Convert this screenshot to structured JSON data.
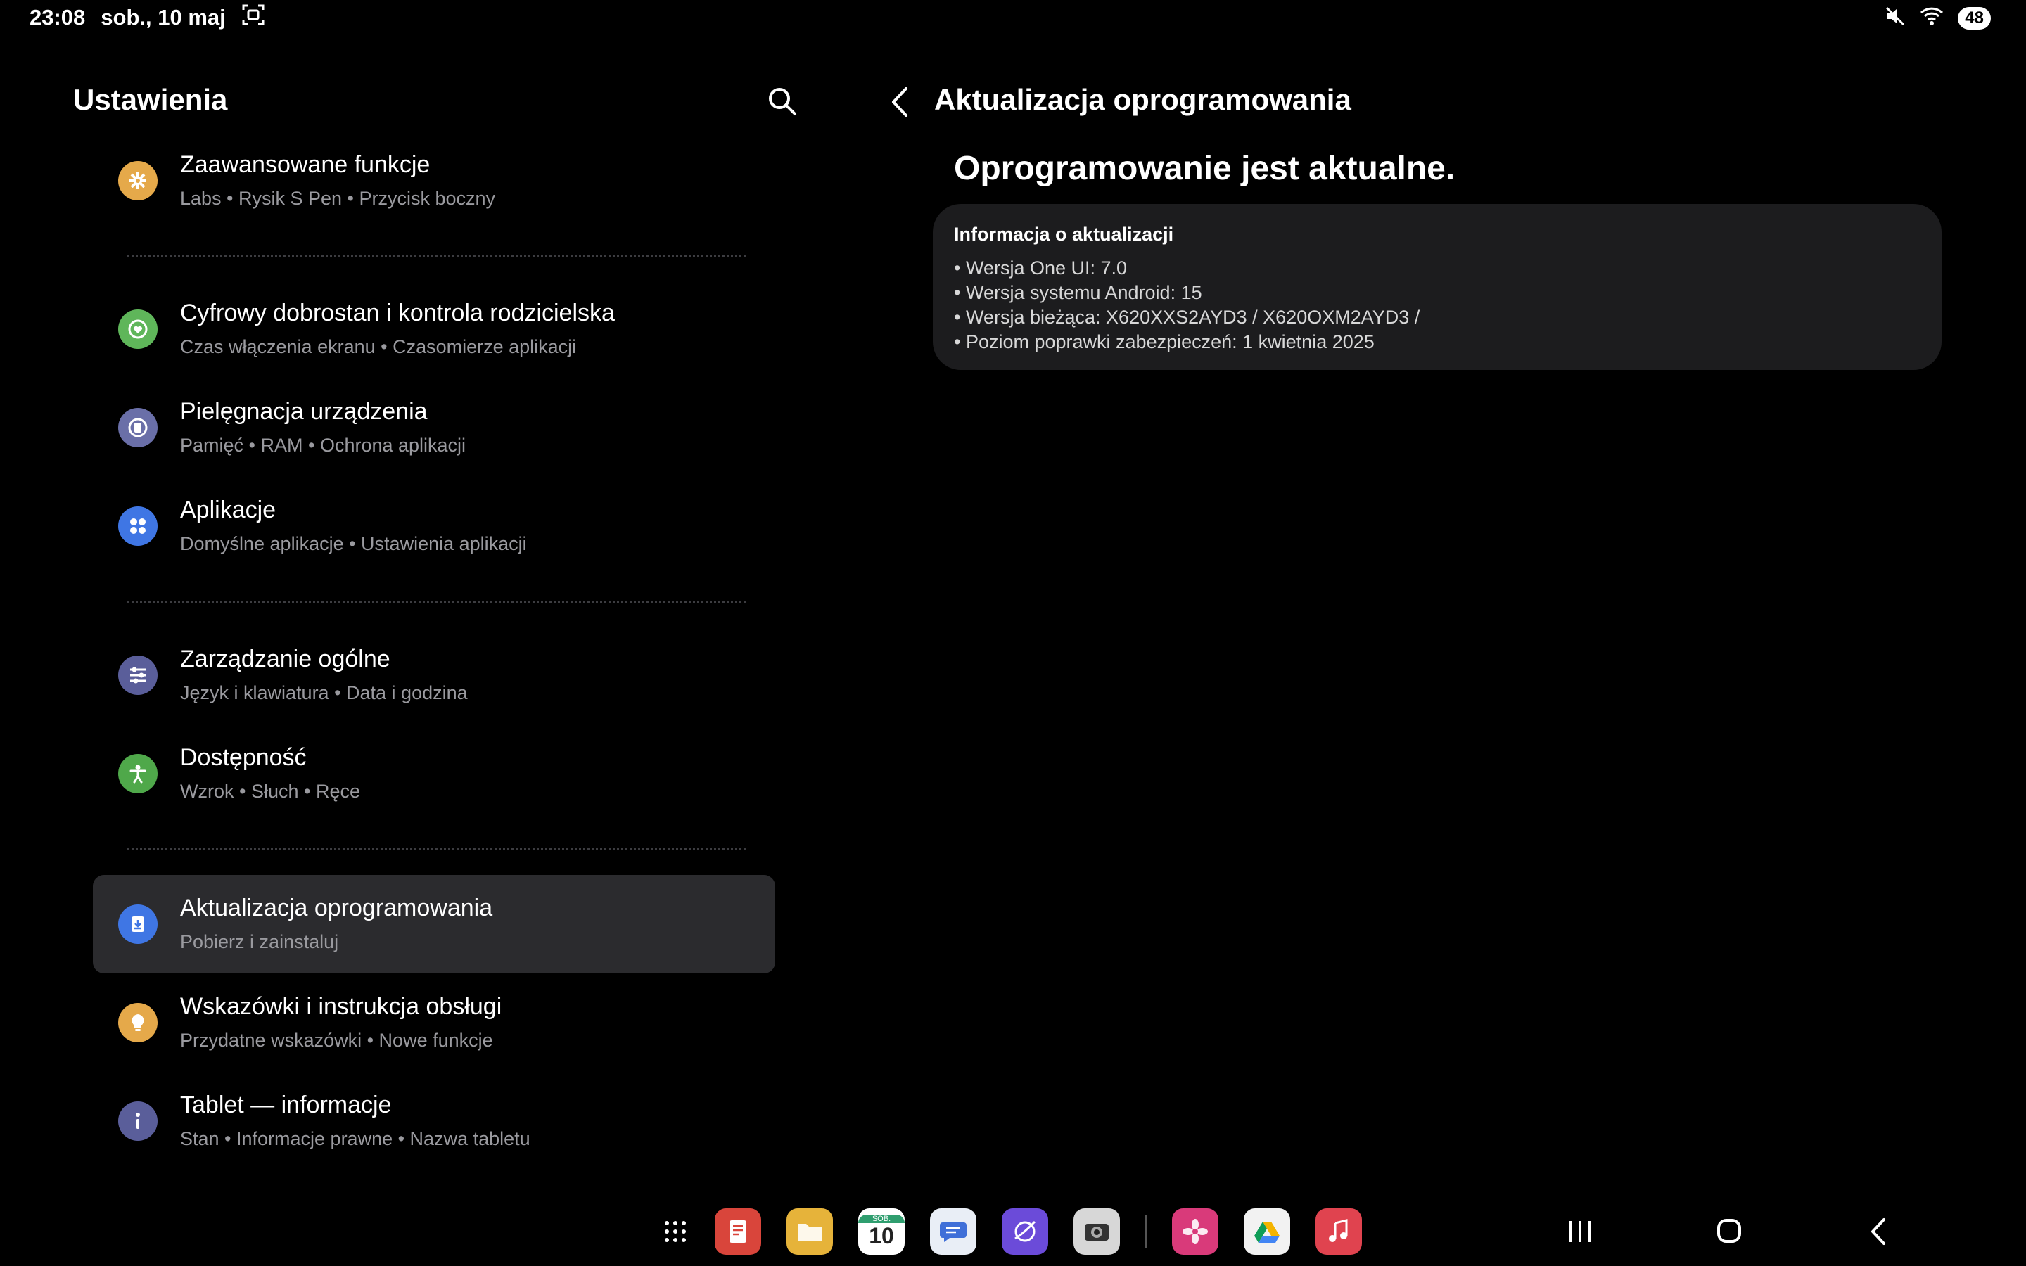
{
  "status_bar": {
    "time": "23:08",
    "date": "sob., 10 maj",
    "screenshot_icon": "screenshot-icon",
    "mute_icon": "mute-icon",
    "wifi_icon": "wifi-icon",
    "battery": "48"
  },
  "left_pane": {
    "title": "Ustawienia",
    "search_icon": "search-icon",
    "items": [
      {
        "title": "Zaawansowane funkcje",
        "subtitle": "Labs  •  Rysik S Pen  •  Przycisk boczny",
        "icon": "puzzle-gear-icon",
        "color": "#e5a94a"
      },
      {
        "title": "Cyfrowy dobrostan i kontrola rodzicielska",
        "subtitle": "Czas włączenia ekranu  •  Czasomierze aplikacji",
        "icon": "heart-circle-icon",
        "color": "#5fb65a"
      },
      {
        "title": "Pielęgnacja urządzenia",
        "subtitle": "Pamięć  •  RAM  •  Ochrona aplikacji",
        "icon": "device-care-icon",
        "color": "#6a6fa8"
      },
      {
        "title": "Aplikacje",
        "subtitle": "Domyślne aplikacje  •  Ustawienia aplikacji",
        "icon": "apps-grid-icon",
        "color": "#3f76e4"
      },
      {
        "title": "Zarządzanie ogólne",
        "subtitle": "Język i klawiatura  •  Data i godzina",
        "icon": "sliders-icon",
        "color": "#5a5e9a"
      },
      {
        "title": "Dostępność",
        "subtitle": "Wzrok  •  Słuch  •  Ręce",
        "icon": "accessibility-icon",
        "color": "#4fa84a"
      },
      {
        "title": "Aktualizacja oprogramowania",
        "subtitle": "Pobierz i zainstaluj",
        "icon": "software-update-icon",
        "color": "#3f76e4"
      },
      {
        "title": "Wskazówki i instrukcja obsługi",
        "subtitle": "Przydatne wskazówki  •  Nowe funkcje",
        "icon": "lightbulb-icon",
        "color": "#e5a94a"
      },
      {
        "title": "Tablet — informacje",
        "subtitle": "Stan  •  Informacje prawne  •  Nazwa tabletu",
        "icon": "info-icon",
        "color": "#5a5e9a"
      }
    ],
    "selected_index": 6
  },
  "right_pane": {
    "back_icon": "back-arrow-icon",
    "title": "Aktualizacja oprogramowania",
    "status": "Oprogramowanie jest aktualne.",
    "card": {
      "heading": "Informacja o aktualizacji",
      "lines": [
        "• Wersja One UI: 7.0",
        "• Wersja systemu Android: 15",
        "• Wersja bieżąca: X620XXS2AYD3 / X620OXM2AYD3 /",
        "• Poziom poprawki zabezpieczeń: 1 kwietnia 2025"
      ]
    }
  },
  "dock": {
    "apps_drawer_icon": "app-drawer-icon",
    "apps": [
      {
        "name": "notes-app-icon",
        "color": "#d9453b"
      },
      {
        "name": "files-app-icon",
        "color": "#e6b33a"
      },
      {
        "name": "calendar-app-icon",
        "color": "#ffffff",
        "label_top": "SOB.",
        "label": "10"
      },
      {
        "name": "messages-app-icon",
        "color": "#e9eef6"
      },
      {
        "name": "internet-app-icon",
        "color": "#6b4bd9"
      },
      {
        "name": "camera-app-icon",
        "color": "#d7d7d7"
      },
      {
        "name": "gallery-app-icon",
        "color": "#d93a7a"
      },
      {
        "name": "drive-app-icon",
        "color": "#f2f2f2"
      },
      {
        "name": "music-app-icon",
        "color": "#e0434f"
      }
    ]
  },
  "nav": {
    "recents_icon": "recents-icon",
    "home_icon": "home-icon",
    "back_icon": "nav-back-icon"
  }
}
